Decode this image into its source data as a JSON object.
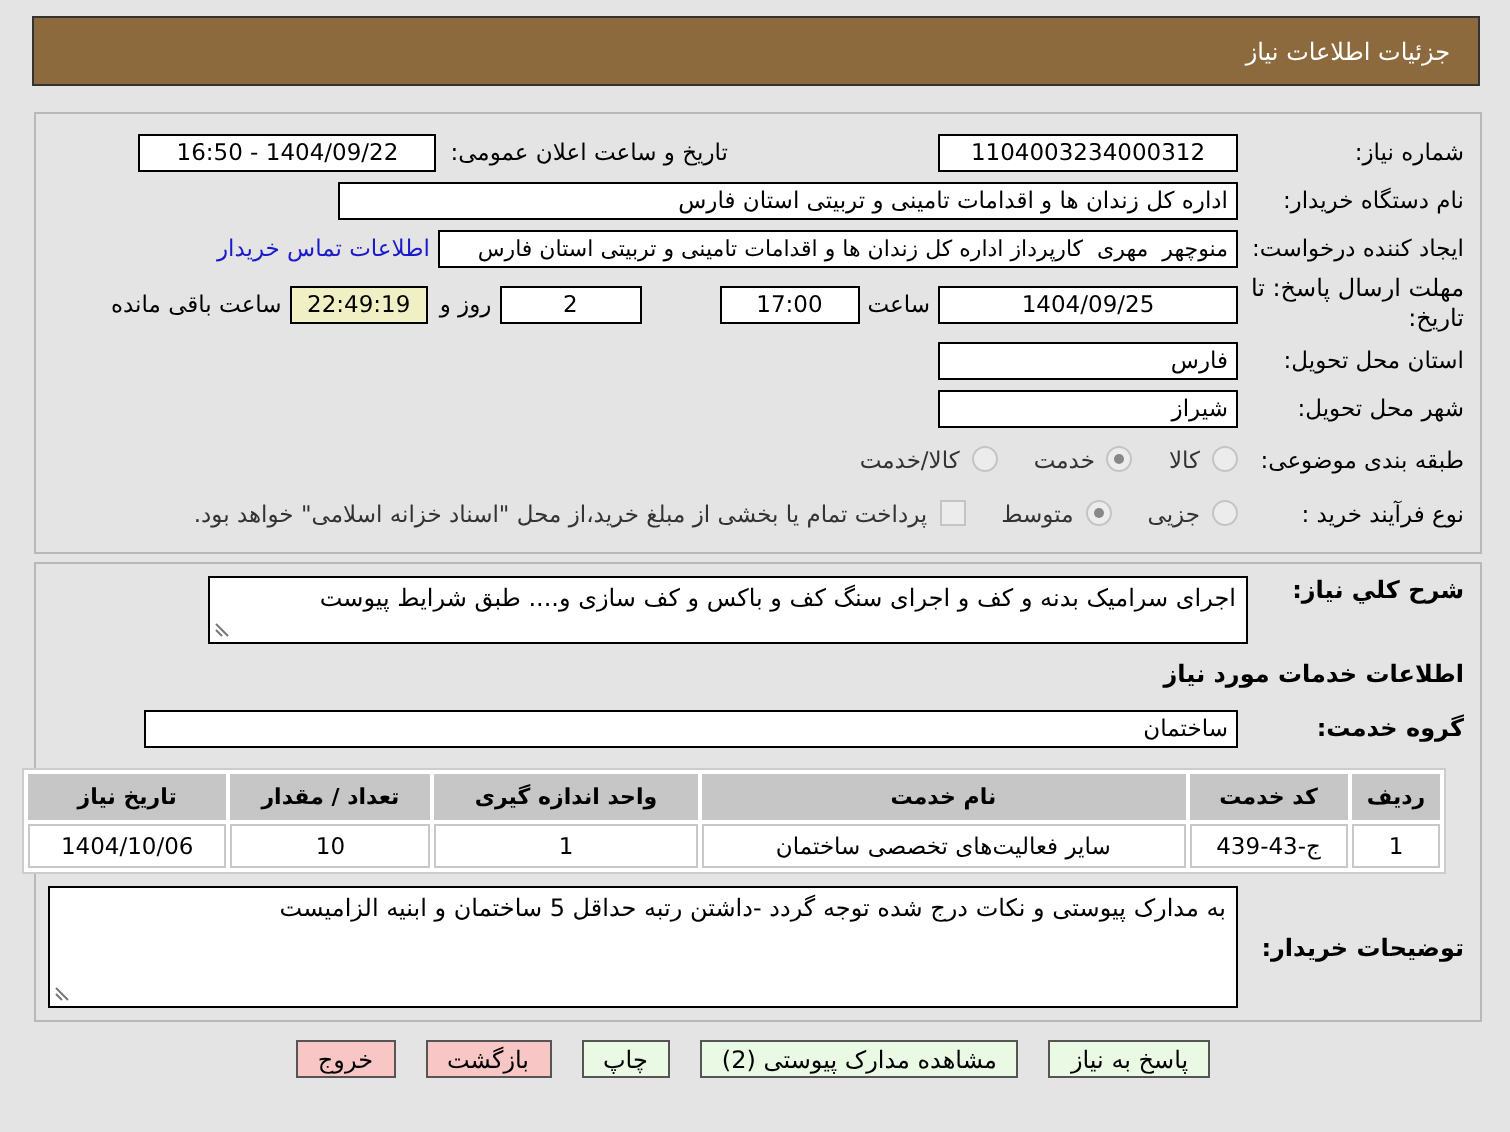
{
  "header": {
    "title": "جزئیات اطلاعات نیاز"
  },
  "details": {
    "need_number": {
      "label": "شماره نیاز:",
      "value": "1104003234000312"
    },
    "announce": {
      "label": "تاریخ و ساعت اعلان عمومی:",
      "value": "1404/09/22 - 16:50"
    },
    "buyer": {
      "label": "نام دستگاه خریدار:",
      "value": "اداره کل زندان ها و اقدامات تامینی و تربیتی استان فارس"
    },
    "creator": {
      "label": "ایجاد کننده درخواست:",
      "value": "منوچهر  مهری  کارپرداز اداره کل زندان ها و اقدامات تامینی و تربیتی استان فارس",
      "link": "اطلاعات تماس خریدار"
    },
    "deadline": {
      "label": "مهلت ارسال پاسخ: تا تاریخ:",
      "date": "1404/09/25",
      "time_label": "ساعت",
      "time": "17:00",
      "days": "2",
      "days_label": "روز و",
      "remaining": "22:49:19",
      "remaining_label": "ساعت باقی مانده"
    },
    "province": {
      "label": "استان محل تحویل:",
      "value": "فارس"
    },
    "city": {
      "label": "شهر محل تحویل:",
      "value": "شیراز"
    },
    "category": {
      "label": "طبقه بندی موضوعی:",
      "options": [
        {
          "label": "کالا",
          "selected": false
        },
        {
          "label": "خدمت",
          "selected": true
        },
        {
          "label": "کالا/خدمت",
          "selected": false
        }
      ]
    },
    "process": {
      "label": "نوع فرآیند خرید :",
      "options": [
        {
          "label": "جزیی",
          "selected": false
        },
        {
          "label": "متوسط",
          "selected": true
        }
      ],
      "payment": {
        "checked": false,
        "text": "پرداخت تمام یا بخشی از مبلغ خرید،از محل \"اسناد خزانه اسلامی\" خواهد بود."
      }
    }
  },
  "services": {
    "description": {
      "label": "شرح کلي نياز:",
      "value": "اجرای سرامیک بدنه و کف و اجرای سنگ کف و باکس و کف سازی و.... طبق شرایط پیوست"
    },
    "heading": "اطلاعات خدمات مورد نیاز",
    "group": {
      "label": "گروه خدمت:",
      "value": "ساختمان"
    },
    "table": {
      "columns": [
        "ردیف",
        "کد خدمت",
        "نام خدمت",
        "واحد اندازه گیری",
        "تعداد / مقدار",
        "تاریخ نیاز"
      ],
      "rows": [
        [
          "1",
          "ج-43-439",
          "سایر فعالیت‌های تخصصی ساختمان",
          "1",
          "10",
          "1404/10/06"
        ]
      ]
    },
    "notes": {
      "label": "توضیحات خریدار:",
      "value": "به مدارک پیوستی و نکات درج شده توجه گردد -داشتن رتبه حداقل 5 ساختمان و ابنیه الزامیست"
    }
  },
  "buttons": [
    {
      "label": "پاسخ به نیاز",
      "kind": "normal"
    },
    {
      "label": "مشاهده مدارک پیوستی (2)",
      "kind": "normal"
    },
    {
      "label": "چاپ",
      "kind": "normal"
    },
    {
      "label": "بازگشت",
      "kind": "danger"
    },
    {
      "label": "خروج",
      "kind": "danger"
    }
  ]
}
